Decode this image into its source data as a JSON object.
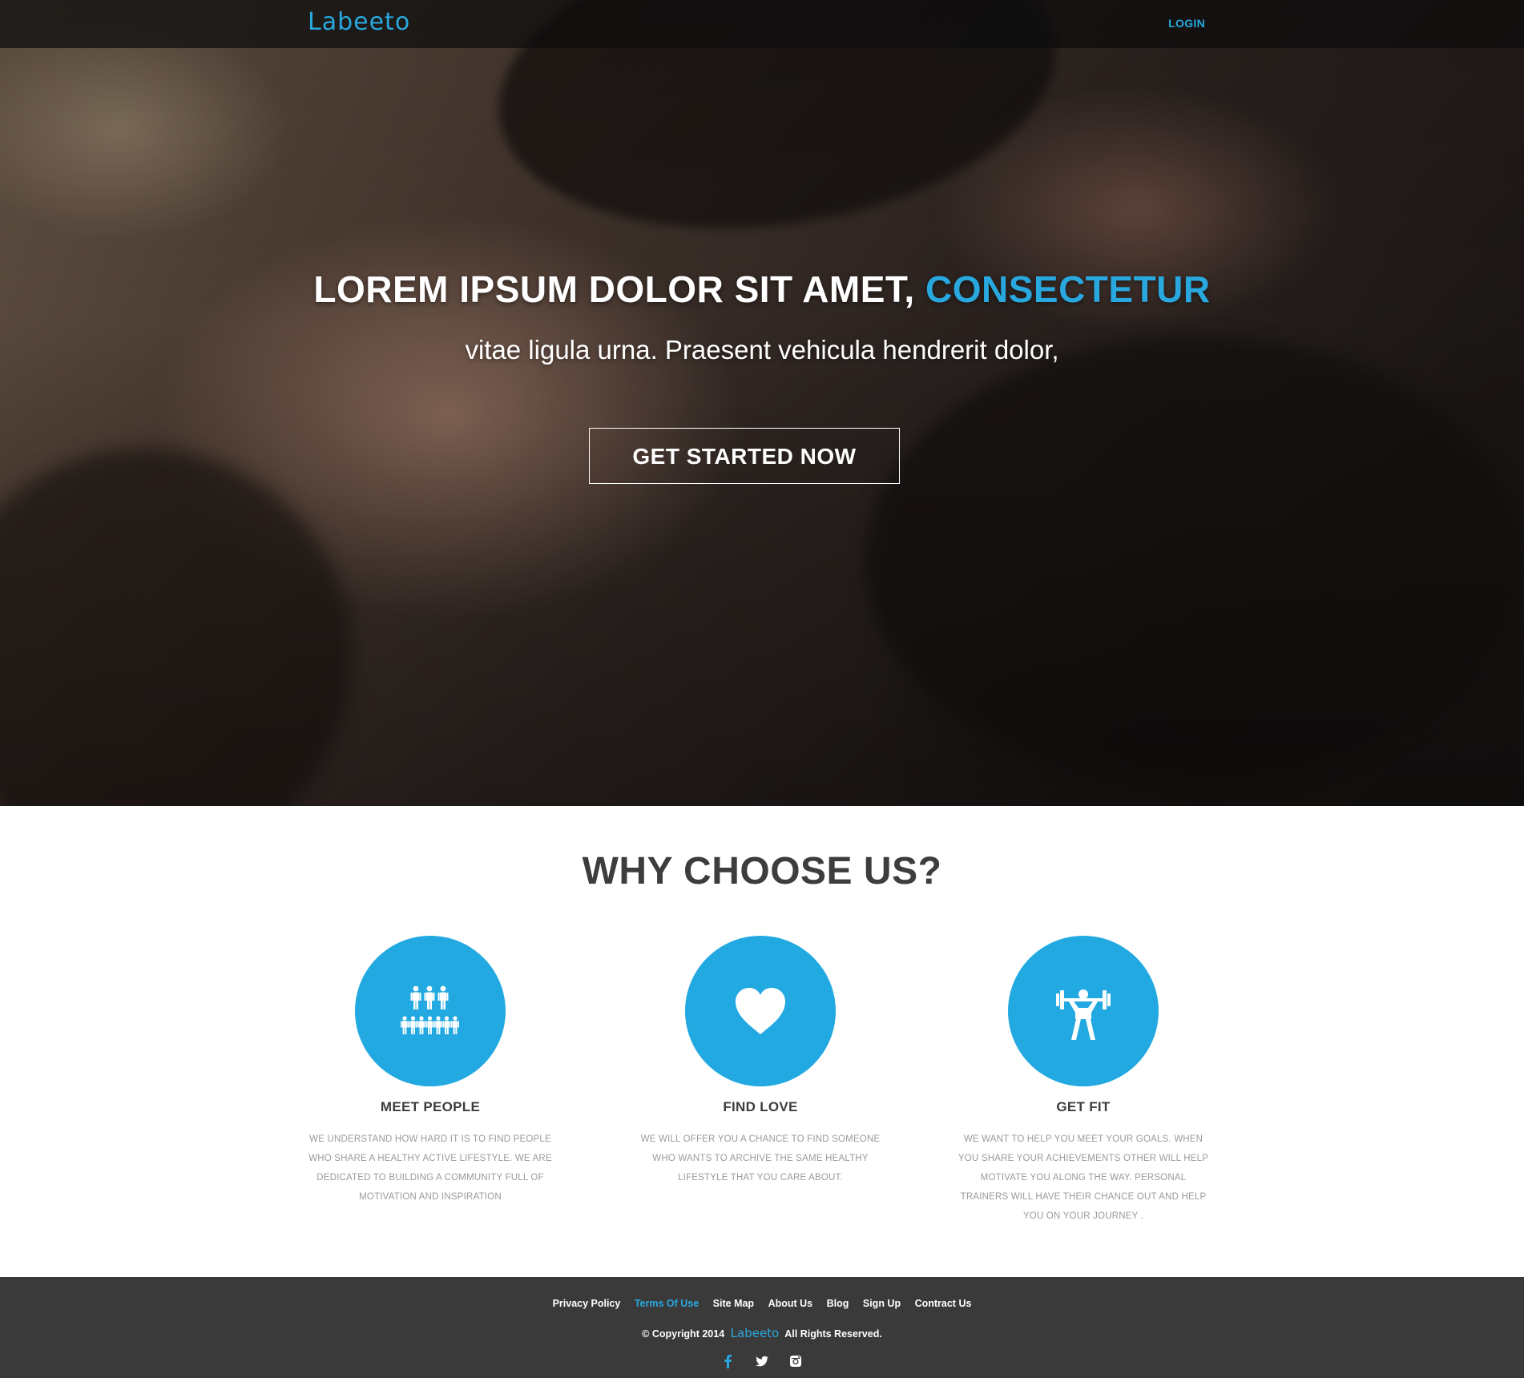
{
  "brand": {
    "logo_text": "Labeeto",
    "accent_color": "#29a8df",
    "circle_color": "#22a9e1"
  },
  "nav": {
    "login_label": "LOGIN"
  },
  "hero": {
    "headline_main": "LOREM IPSUM DOLOR SIT AMET, ",
    "headline_accent": "CONSECTETUR",
    "subline": "vitae ligula urna. Praesent vehicula hendrerit dolor,",
    "cta_label": "GET STARTED NOW"
  },
  "why": {
    "title": "WHY CHOOSE US?",
    "features": [
      {
        "icon": "people-group-icon",
        "title": "MEET PEOPLE",
        "text": "We understand how hard it is to find people who share a healthy active lifestyle. We are dedicated to building a community full of motivation and inspiration"
      },
      {
        "icon": "heart-icon",
        "title": "FIND LOVE",
        "text": "We will offer you a chance to find someone who wants to archive the same healthy lifestyle that you care about."
      },
      {
        "icon": "weightlifter-icon",
        "title": "GET FIT",
        "text": "We want to help you meet your goals. When you share your achievements other will help motivate you along the way. Personal trainers will have their chance out and help you on your journey ."
      }
    ]
  },
  "footer": {
    "links": [
      {
        "label": "Privacy Policy",
        "active": false
      },
      {
        "label": "Terms Of Use",
        "active": true
      },
      {
        "label": "Site Map",
        "active": false
      },
      {
        "label": "About Us",
        "active": false
      },
      {
        "label": "Blog",
        "active": false
      },
      {
        "label": "Sign Up",
        "active": false
      },
      {
        "label": "Contract Us",
        "active": false
      }
    ],
    "copyright_prefix": "© Copyright 2014",
    "copyright_logo": "Labeeto",
    "copyright_suffix": "All Rights Reserved.",
    "socials": [
      "facebook-icon",
      "twitter-icon",
      "instagram-icon"
    ]
  }
}
